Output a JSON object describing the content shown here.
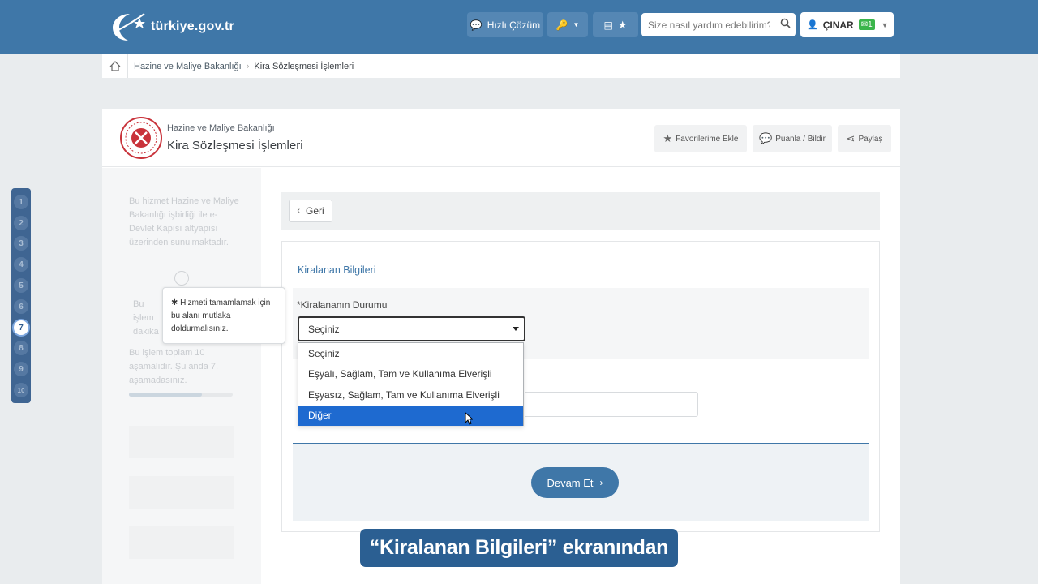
{
  "header": {
    "logo_text": "türkiye.gov.tr",
    "quick_solution_label": "Hızlı Çözüm",
    "search_placeholder": "Size nasıl yardım edebilirim?",
    "user_name": "ÇINAR",
    "mail_count": "1",
    "brand_color": "#3f77a8"
  },
  "breadcrumb": {
    "items": [
      "Hazine ve Maliye Bakanlığı",
      "Kira Sözleşmesi İşlemleri"
    ]
  },
  "service": {
    "organization": "Hazine ve Maliye Bakanlığı",
    "title": "Kira Sözleşmesi İşlemleri",
    "actions": [
      "Favorilerime Ekle",
      "Puanla / Bildir",
      "Paylaş"
    ]
  },
  "sidebar": {
    "info": "Bu hizmet Hazine ve Maliye Bakanlığı işbirliği ile e-Devlet Kapısı altyapısı üzerinden sunulmaktadır.",
    "duration_partial": "Bu işlem dakika",
    "steps_info": "Bu işlem toplam 10 aşamalıdır. Şu anda 7. aşamadasınız.",
    "progress_fraction": 0.7
  },
  "tooltip": {
    "text": "✱ Hizmeti tamamlamak için bu alanı mutlaka doldurmalısınız."
  },
  "form": {
    "back_label": "Geri",
    "section_title": "Kiralanan Bilgileri",
    "field_label": "*Kiralananın Durumu",
    "selected_value": "Seçiniz",
    "options": [
      "Seçiniz",
      "Eşyalı, Sağlam, Tam ve Kullanıma Elverişli",
      "Eşyasız, Sağlam, Tam ve Kullanıma Elverişli",
      "Diğer"
    ],
    "highlighted_option": "Diğer",
    "continue_label": "Devam Et"
  },
  "steps": {
    "labels": [
      "1",
      "2",
      "3",
      "4",
      "5",
      "6",
      "7",
      "8",
      "9",
      "10"
    ],
    "current": "7"
  },
  "caption": "“Kiralanan Bilgileri” ekranından"
}
